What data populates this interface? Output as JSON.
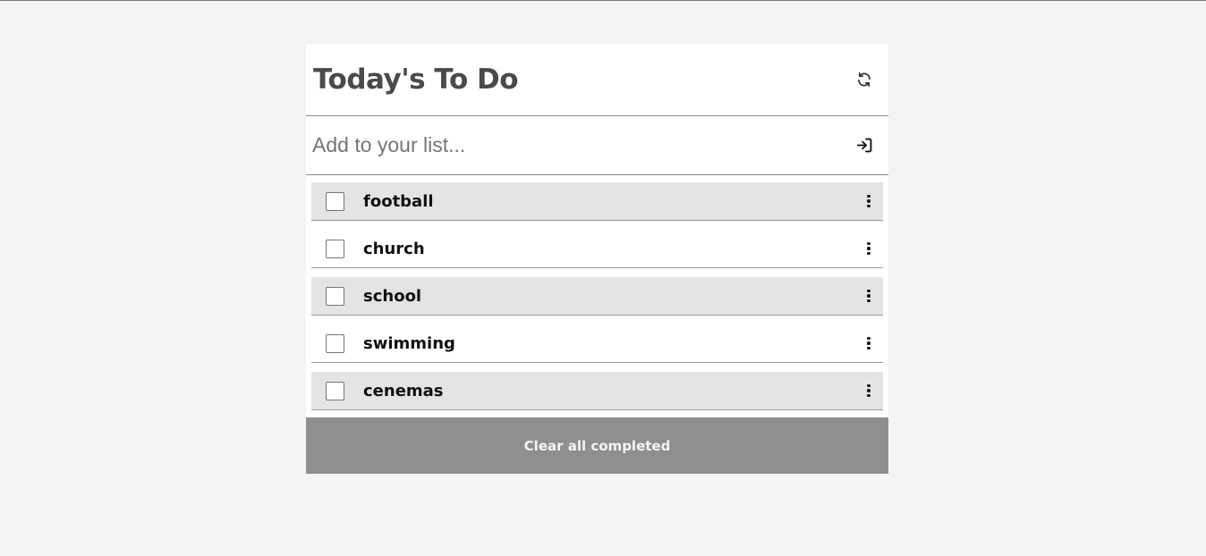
{
  "header": {
    "title": "Today's To Do",
    "refresh_icon": "refresh-icon"
  },
  "add": {
    "placeholder": "Add to your list...",
    "value": "",
    "submit_icon": "enter-icon"
  },
  "items": [
    {
      "label": "football",
      "completed": false,
      "shaded": true
    },
    {
      "label": "church",
      "completed": false,
      "shaded": false
    },
    {
      "label": "school",
      "completed": false,
      "shaded": true
    },
    {
      "label": "swimming",
      "completed": false,
      "shaded": false
    },
    {
      "label": "cenemas",
      "completed": false,
      "shaded": true
    }
  ],
  "footer": {
    "clear_label": "Clear all completed"
  },
  "colors": {
    "page_bg": "#f4f4f4",
    "card_bg": "#ffffff",
    "shaded_row": "#e4e4e4",
    "clear_button_bg": "#8f8f8d",
    "title_text": "#4a4a4a"
  }
}
